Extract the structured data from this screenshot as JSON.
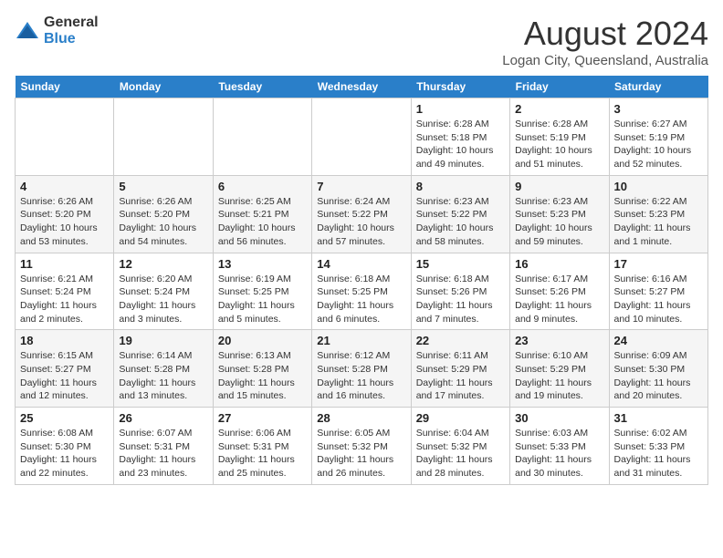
{
  "header": {
    "logo_general": "General",
    "logo_blue": "Blue",
    "month_year": "August 2024",
    "location": "Logan City, Queensland, Australia"
  },
  "days_of_week": [
    "Sunday",
    "Monday",
    "Tuesday",
    "Wednesday",
    "Thursday",
    "Friday",
    "Saturday"
  ],
  "weeks": [
    [
      {
        "day": "",
        "info": ""
      },
      {
        "day": "",
        "info": ""
      },
      {
        "day": "",
        "info": ""
      },
      {
        "day": "",
        "info": ""
      },
      {
        "day": "1",
        "info": "Sunrise: 6:28 AM\nSunset: 5:18 PM\nDaylight: 10 hours and 49 minutes."
      },
      {
        "day": "2",
        "info": "Sunrise: 6:28 AM\nSunset: 5:19 PM\nDaylight: 10 hours and 51 minutes."
      },
      {
        "day": "3",
        "info": "Sunrise: 6:27 AM\nSunset: 5:19 PM\nDaylight: 10 hours and 52 minutes."
      }
    ],
    [
      {
        "day": "4",
        "info": "Sunrise: 6:26 AM\nSunset: 5:20 PM\nDaylight: 10 hours and 53 minutes."
      },
      {
        "day": "5",
        "info": "Sunrise: 6:26 AM\nSunset: 5:20 PM\nDaylight: 10 hours and 54 minutes."
      },
      {
        "day": "6",
        "info": "Sunrise: 6:25 AM\nSunset: 5:21 PM\nDaylight: 10 hours and 56 minutes."
      },
      {
        "day": "7",
        "info": "Sunrise: 6:24 AM\nSunset: 5:22 PM\nDaylight: 10 hours and 57 minutes."
      },
      {
        "day": "8",
        "info": "Sunrise: 6:23 AM\nSunset: 5:22 PM\nDaylight: 10 hours and 58 minutes."
      },
      {
        "day": "9",
        "info": "Sunrise: 6:23 AM\nSunset: 5:23 PM\nDaylight: 10 hours and 59 minutes."
      },
      {
        "day": "10",
        "info": "Sunrise: 6:22 AM\nSunset: 5:23 PM\nDaylight: 11 hours and 1 minute."
      }
    ],
    [
      {
        "day": "11",
        "info": "Sunrise: 6:21 AM\nSunset: 5:24 PM\nDaylight: 11 hours and 2 minutes."
      },
      {
        "day": "12",
        "info": "Sunrise: 6:20 AM\nSunset: 5:24 PM\nDaylight: 11 hours and 3 minutes."
      },
      {
        "day": "13",
        "info": "Sunrise: 6:19 AM\nSunset: 5:25 PM\nDaylight: 11 hours and 5 minutes."
      },
      {
        "day": "14",
        "info": "Sunrise: 6:18 AM\nSunset: 5:25 PM\nDaylight: 11 hours and 6 minutes."
      },
      {
        "day": "15",
        "info": "Sunrise: 6:18 AM\nSunset: 5:26 PM\nDaylight: 11 hours and 7 minutes."
      },
      {
        "day": "16",
        "info": "Sunrise: 6:17 AM\nSunset: 5:26 PM\nDaylight: 11 hours and 9 minutes."
      },
      {
        "day": "17",
        "info": "Sunrise: 6:16 AM\nSunset: 5:27 PM\nDaylight: 11 hours and 10 minutes."
      }
    ],
    [
      {
        "day": "18",
        "info": "Sunrise: 6:15 AM\nSunset: 5:27 PM\nDaylight: 11 hours and 12 minutes."
      },
      {
        "day": "19",
        "info": "Sunrise: 6:14 AM\nSunset: 5:28 PM\nDaylight: 11 hours and 13 minutes."
      },
      {
        "day": "20",
        "info": "Sunrise: 6:13 AM\nSunset: 5:28 PM\nDaylight: 11 hours and 15 minutes."
      },
      {
        "day": "21",
        "info": "Sunrise: 6:12 AM\nSunset: 5:28 PM\nDaylight: 11 hours and 16 minutes."
      },
      {
        "day": "22",
        "info": "Sunrise: 6:11 AM\nSunset: 5:29 PM\nDaylight: 11 hours and 17 minutes."
      },
      {
        "day": "23",
        "info": "Sunrise: 6:10 AM\nSunset: 5:29 PM\nDaylight: 11 hours and 19 minutes."
      },
      {
        "day": "24",
        "info": "Sunrise: 6:09 AM\nSunset: 5:30 PM\nDaylight: 11 hours and 20 minutes."
      }
    ],
    [
      {
        "day": "25",
        "info": "Sunrise: 6:08 AM\nSunset: 5:30 PM\nDaylight: 11 hours and 22 minutes."
      },
      {
        "day": "26",
        "info": "Sunrise: 6:07 AM\nSunset: 5:31 PM\nDaylight: 11 hours and 23 minutes."
      },
      {
        "day": "27",
        "info": "Sunrise: 6:06 AM\nSunset: 5:31 PM\nDaylight: 11 hours and 25 minutes."
      },
      {
        "day": "28",
        "info": "Sunrise: 6:05 AM\nSunset: 5:32 PM\nDaylight: 11 hours and 26 minutes."
      },
      {
        "day": "29",
        "info": "Sunrise: 6:04 AM\nSunset: 5:32 PM\nDaylight: 11 hours and 28 minutes."
      },
      {
        "day": "30",
        "info": "Sunrise: 6:03 AM\nSunset: 5:33 PM\nDaylight: 11 hours and 30 minutes."
      },
      {
        "day": "31",
        "info": "Sunrise: 6:02 AM\nSunset: 5:33 PM\nDaylight: 11 hours and 31 minutes."
      }
    ]
  ]
}
